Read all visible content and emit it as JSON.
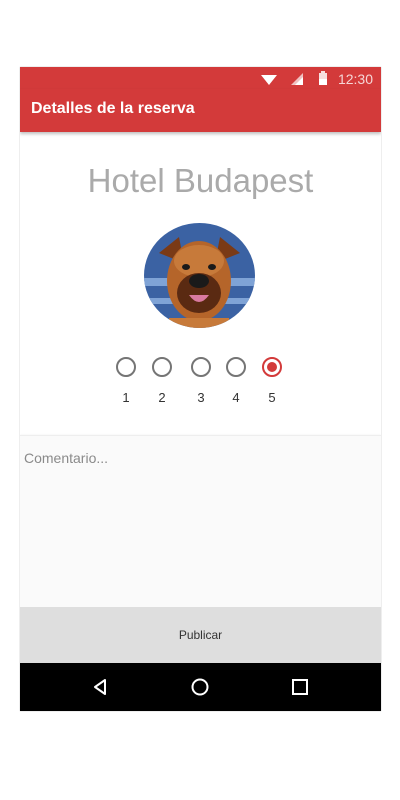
{
  "status_bar": {
    "time": "12:30",
    "icons": [
      "wifi-icon",
      "signal-icon",
      "battery-icon"
    ],
    "color": "#d33a3a"
  },
  "app_bar": {
    "title": "Detalles de la reserva",
    "color": "#d33a3a"
  },
  "hotel": {
    "name": "Hotel Budapest",
    "avatar_icon": "dog-avatar"
  },
  "rating": {
    "options": [
      "1",
      "2",
      "3",
      "4",
      "5"
    ],
    "selected": "5"
  },
  "comment": {
    "placeholder": "Comentario..."
  },
  "publish": {
    "label": "Publicar"
  },
  "nav": {
    "icons": [
      "back-icon",
      "home-icon",
      "recents-icon"
    ]
  }
}
